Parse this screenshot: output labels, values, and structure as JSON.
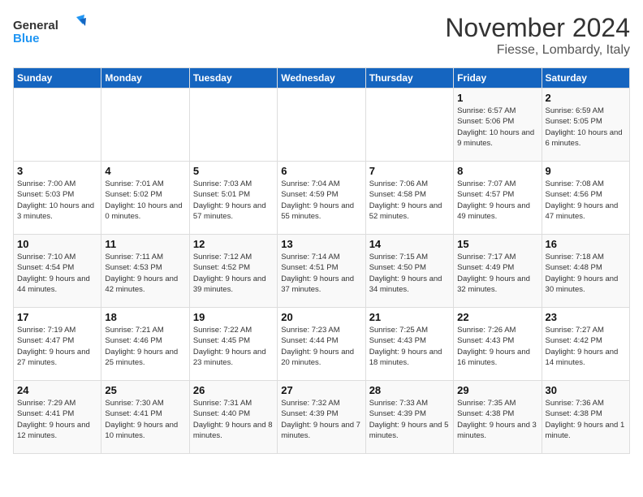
{
  "header": {
    "logo_line1": "General",
    "logo_line2": "Blue",
    "month": "November 2024",
    "location": "Fiesse, Lombardy, Italy"
  },
  "weekdays": [
    "Sunday",
    "Monday",
    "Tuesday",
    "Wednesday",
    "Thursday",
    "Friday",
    "Saturday"
  ],
  "weeks": [
    [
      {
        "day": "",
        "info": ""
      },
      {
        "day": "",
        "info": ""
      },
      {
        "day": "",
        "info": ""
      },
      {
        "day": "",
        "info": ""
      },
      {
        "day": "",
        "info": ""
      },
      {
        "day": "1",
        "info": "Sunrise: 6:57 AM\nSunset: 5:06 PM\nDaylight: 10 hours and 9 minutes."
      },
      {
        "day": "2",
        "info": "Sunrise: 6:59 AM\nSunset: 5:05 PM\nDaylight: 10 hours and 6 minutes."
      }
    ],
    [
      {
        "day": "3",
        "info": "Sunrise: 7:00 AM\nSunset: 5:03 PM\nDaylight: 10 hours and 3 minutes."
      },
      {
        "day": "4",
        "info": "Sunrise: 7:01 AM\nSunset: 5:02 PM\nDaylight: 10 hours and 0 minutes."
      },
      {
        "day": "5",
        "info": "Sunrise: 7:03 AM\nSunset: 5:01 PM\nDaylight: 9 hours and 57 minutes."
      },
      {
        "day": "6",
        "info": "Sunrise: 7:04 AM\nSunset: 4:59 PM\nDaylight: 9 hours and 55 minutes."
      },
      {
        "day": "7",
        "info": "Sunrise: 7:06 AM\nSunset: 4:58 PM\nDaylight: 9 hours and 52 minutes."
      },
      {
        "day": "8",
        "info": "Sunrise: 7:07 AM\nSunset: 4:57 PM\nDaylight: 9 hours and 49 minutes."
      },
      {
        "day": "9",
        "info": "Sunrise: 7:08 AM\nSunset: 4:56 PM\nDaylight: 9 hours and 47 minutes."
      }
    ],
    [
      {
        "day": "10",
        "info": "Sunrise: 7:10 AM\nSunset: 4:54 PM\nDaylight: 9 hours and 44 minutes."
      },
      {
        "day": "11",
        "info": "Sunrise: 7:11 AM\nSunset: 4:53 PM\nDaylight: 9 hours and 42 minutes."
      },
      {
        "day": "12",
        "info": "Sunrise: 7:12 AM\nSunset: 4:52 PM\nDaylight: 9 hours and 39 minutes."
      },
      {
        "day": "13",
        "info": "Sunrise: 7:14 AM\nSunset: 4:51 PM\nDaylight: 9 hours and 37 minutes."
      },
      {
        "day": "14",
        "info": "Sunrise: 7:15 AM\nSunset: 4:50 PM\nDaylight: 9 hours and 34 minutes."
      },
      {
        "day": "15",
        "info": "Sunrise: 7:17 AM\nSunset: 4:49 PM\nDaylight: 9 hours and 32 minutes."
      },
      {
        "day": "16",
        "info": "Sunrise: 7:18 AM\nSunset: 4:48 PM\nDaylight: 9 hours and 30 minutes."
      }
    ],
    [
      {
        "day": "17",
        "info": "Sunrise: 7:19 AM\nSunset: 4:47 PM\nDaylight: 9 hours and 27 minutes."
      },
      {
        "day": "18",
        "info": "Sunrise: 7:21 AM\nSunset: 4:46 PM\nDaylight: 9 hours and 25 minutes."
      },
      {
        "day": "19",
        "info": "Sunrise: 7:22 AM\nSunset: 4:45 PM\nDaylight: 9 hours and 23 minutes."
      },
      {
        "day": "20",
        "info": "Sunrise: 7:23 AM\nSunset: 4:44 PM\nDaylight: 9 hours and 20 minutes."
      },
      {
        "day": "21",
        "info": "Sunrise: 7:25 AM\nSunset: 4:43 PM\nDaylight: 9 hours and 18 minutes."
      },
      {
        "day": "22",
        "info": "Sunrise: 7:26 AM\nSunset: 4:43 PM\nDaylight: 9 hours and 16 minutes."
      },
      {
        "day": "23",
        "info": "Sunrise: 7:27 AM\nSunset: 4:42 PM\nDaylight: 9 hours and 14 minutes."
      }
    ],
    [
      {
        "day": "24",
        "info": "Sunrise: 7:29 AM\nSunset: 4:41 PM\nDaylight: 9 hours and 12 minutes."
      },
      {
        "day": "25",
        "info": "Sunrise: 7:30 AM\nSunset: 4:41 PM\nDaylight: 9 hours and 10 minutes."
      },
      {
        "day": "26",
        "info": "Sunrise: 7:31 AM\nSunset: 4:40 PM\nDaylight: 9 hours and 8 minutes."
      },
      {
        "day": "27",
        "info": "Sunrise: 7:32 AM\nSunset: 4:39 PM\nDaylight: 9 hours and 7 minutes."
      },
      {
        "day": "28",
        "info": "Sunrise: 7:33 AM\nSunset: 4:39 PM\nDaylight: 9 hours and 5 minutes."
      },
      {
        "day": "29",
        "info": "Sunrise: 7:35 AM\nSunset: 4:38 PM\nDaylight: 9 hours and 3 minutes."
      },
      {
        "day": "30",
        "info": "Sunrise: 7:36 AM\nSunset: 4:38 PM\nDaylight: 9 hours and 1 minute."
      }
    ]
  ]
}
